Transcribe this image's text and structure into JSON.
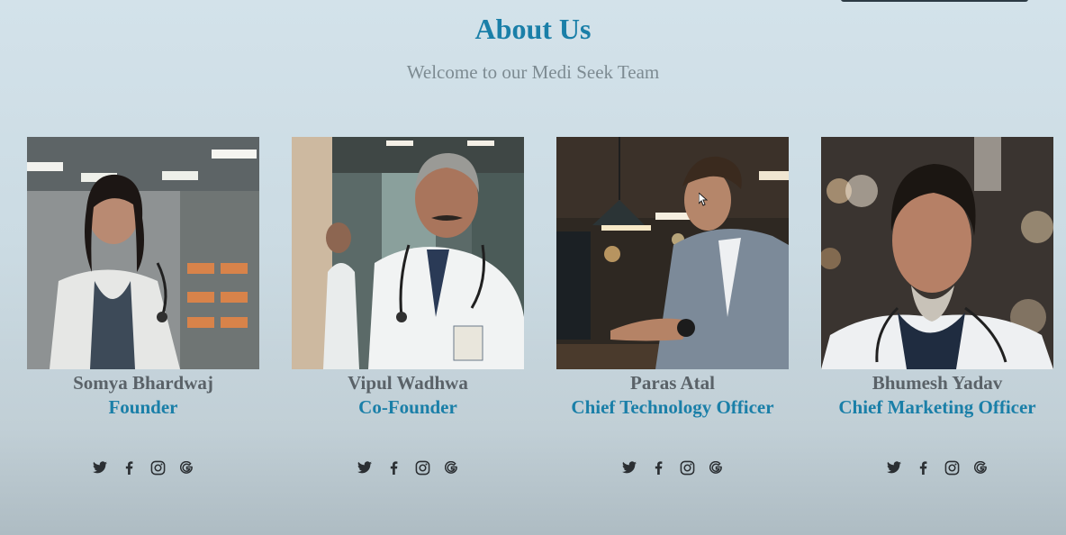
{
  "header": {
    "title": "About Us",
    "subtitle": "Welcome to our Medi Seek Team"
  },
  "colors": {
    "accent": "#1a7fa8",
    "name_text": "#5a6268",
    "subtitle_text": "#7d8b92",
    "icon": "#2b2f33"
  },
  "team": [
    {
      "name": "Somya Bhardwaj",
      "role": "Founder",
      "socials": [
        "twitter-icon",
        "facebook-icon",
        "instagram-icon",
        "google-icon"
      ]
    },
    {
      "name": "Vipul Wadhwa",
      "role": "Co-Founder",
      "socials": [
        "twitter-icon",
        "facebook-icon",
        "instagram-icon",
        "google-icon"
      ]
    },
    {
      "name": "Paras Atal",
      "role": "Chief Technology Officer",
      "socials": [
        "twitter-icon",
        "facebook-icon",
        "instagram-icon",
        "google-icon"
      ]
    },
    {
      "name": "Bhumesh Yadav",
      "role": "Chief Marketing Officer",
      "socials": [
        "twitter-icon",
        "facebook-icon",
        "instagram-icon",
        "google-icon"
      ]
    }
  ]
}
